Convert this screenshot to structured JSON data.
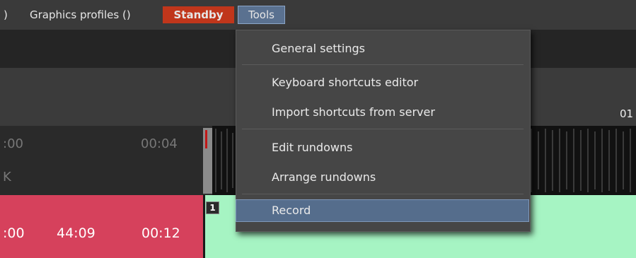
{
  "menubar": {
    "fragment": ")",
    "graphics_profiles": "Graphics profiles ()",
    "standby": "Standby",
    "tools": "Tools"
  },
  "timeline": {
    "ruler_label": "01",
    "left_time_start": ":00",
    "left_time_end": "00:04",
    "left_letter": "K",
    "row_time_start": ":00",
    "row_time_mid": "44:09",
    "row_time_end": "00:12",
    "clip_badge": "1"
  },
  "tools_menu": {
    "items": [
      {
        "label": "General settings"
      },
      {
        "label": "Keyboard shortcuts editor"
      },
      {
        "label": "Import shortcuts from server"
      },
      {
        "label": "Edit rundowns"
      },
      {
        "label": "Arrange rundowns"
      },
      {
        "label": "Record"
      }
    ]
  },
  "colors": {
    "standby": "#c0361b",
    "tools_active": "#5a7190",
    "row_pink": "#d6415c",
    "row_green": "#a6f4c3"
  }
}
